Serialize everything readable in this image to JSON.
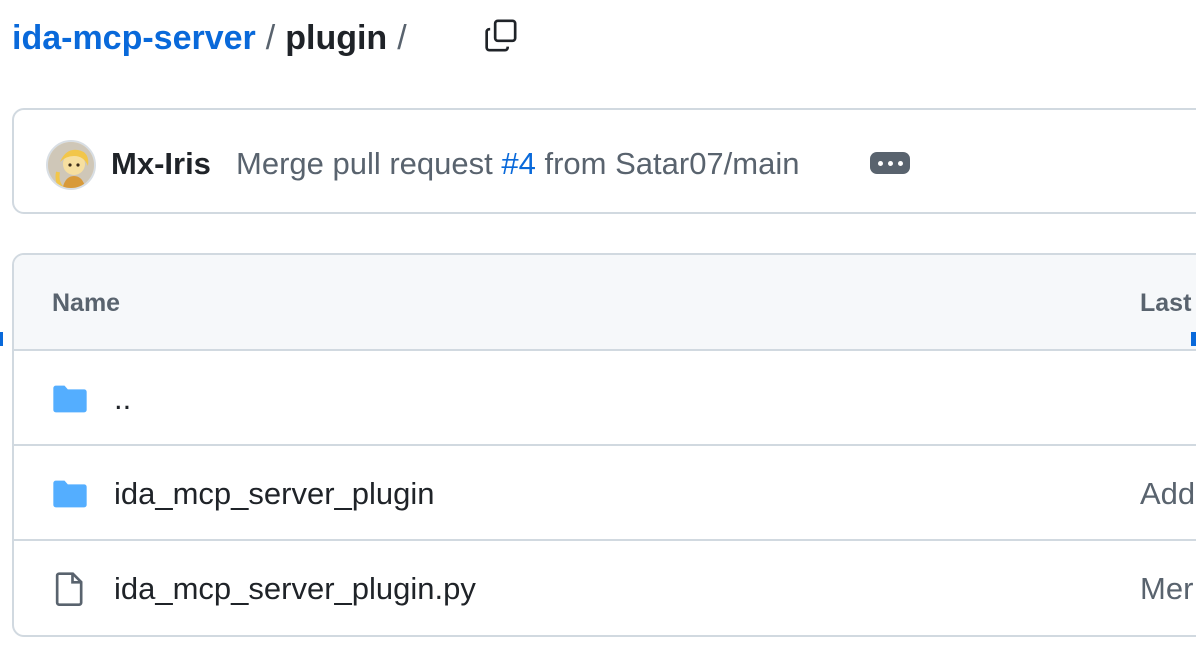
{
  "breadcrumb": {
    "repo": "ida-mcp-server",
    "separator": "/",
    "current": "plugin",
    "trailing": "/",
    "copy_icon": "copy-icon"
  },
  "commit": {
    "avatar_icon": "avatar",
    "author": "Mx-Iris",
    "message_prefix": "Merge pull request",
    "pr_link": "#4",
    "message_suffix": "from Satar07/main",
    "more_icon": "ellipsis-icon"
  },
  "table": {
    "columns": {
      "name": "Name",
      "last_commit": "Last"
    },
    "rows": [
      {
        "icon": "folder-icon",
        "name": "..",
        "message": ""
      },
      {
        "icon": "folder-icon",
        "name": "ida_mcp_server_plugin",
        "message": "Add"
      },
      {
        "icon": "file-icon",
        "name": "ida_mcp_server_plugin.py",
        "message": "Mer"
      }
    ]
  },
  "colors": {
    "link": "#0969da",
    "folder": "#54aeff",
    "border": "#d1d9e0",
    "muted": "#59636e"
  }
}
